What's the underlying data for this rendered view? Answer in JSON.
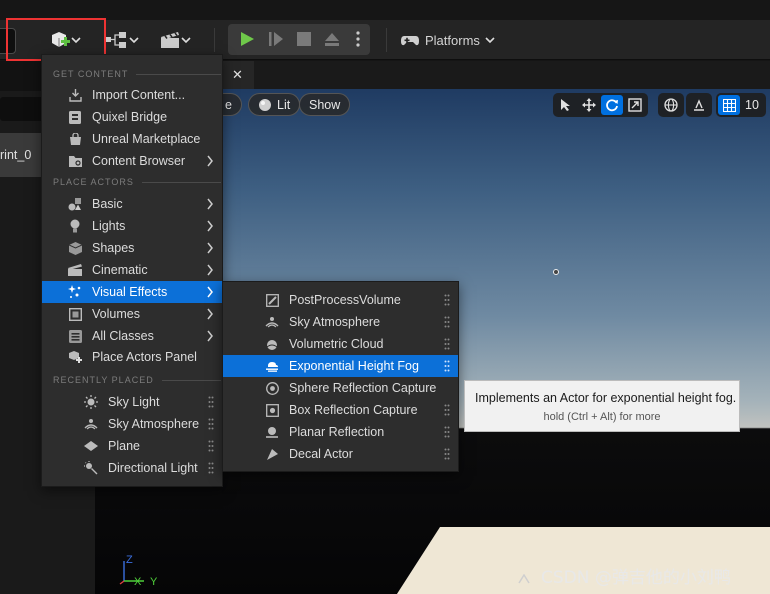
{
  "toolbar": {
    "platforms_label": "Platforms"
  },
  "left_panel": {
    "row_label": "rint_0"
  },
  "viewport": {
    "lit_label": "Lit",
    "show_label": "Show",
    "partial_label": "e",
    "grid_value": "10"
  },
  "add_menu": {
    "sections": {
      "get_content": "GET CONTENT",
      "place_actors": "PLACE ACTORS",
      "recently_placed": "RECENTLY PLACED"
    },
    "get_content_items": [
      "Import Content...",
      "Quixel Bridge",
      "Unreal Marketplace",
      "Content Browser"
    ],
    "place_actors_items": [
      "Basic",
      "Lights",
      "Shapes",
      "Cinematic",
      "Visual Effects",
      "Volumes",
      "All Classes",
      "Place Actors Panel"
    ],
    "recently_placed_items": [
      "Sky Light",
      "Sky Atmosphere",
      "Plane",
      "Directional Light"
    ]
  },
  "visual_effects_menu": {
    "items": [
      "PostProcessVolume",
      "Sky Atmosphere",
      "Volumetric Cloud",
      "Exponential Height Fog",
      "Sphere Reflection Capture",
      "Box Reflection Capture",
      "Planar Reflection",
      "Decal Actor"
    ],
    "selected": "Exponential Height Fog"
  },
  "tooltip": {
    "text": "Implements an Actor for exponential height fog.",
    "hint": "hold (Ctrl + Alt) for more"
  },
  "gizmo": {
    "z": "Z",
    "x": "X",
    "y": "Y"
  },
  "watermark": "CSDN @弹吉他的小刘鸭",
  "colors": {
    "selection": "#0c70d8",
    "highlight_box": "#e33333",
    "play_green": "#6fc94a"
  }
}
